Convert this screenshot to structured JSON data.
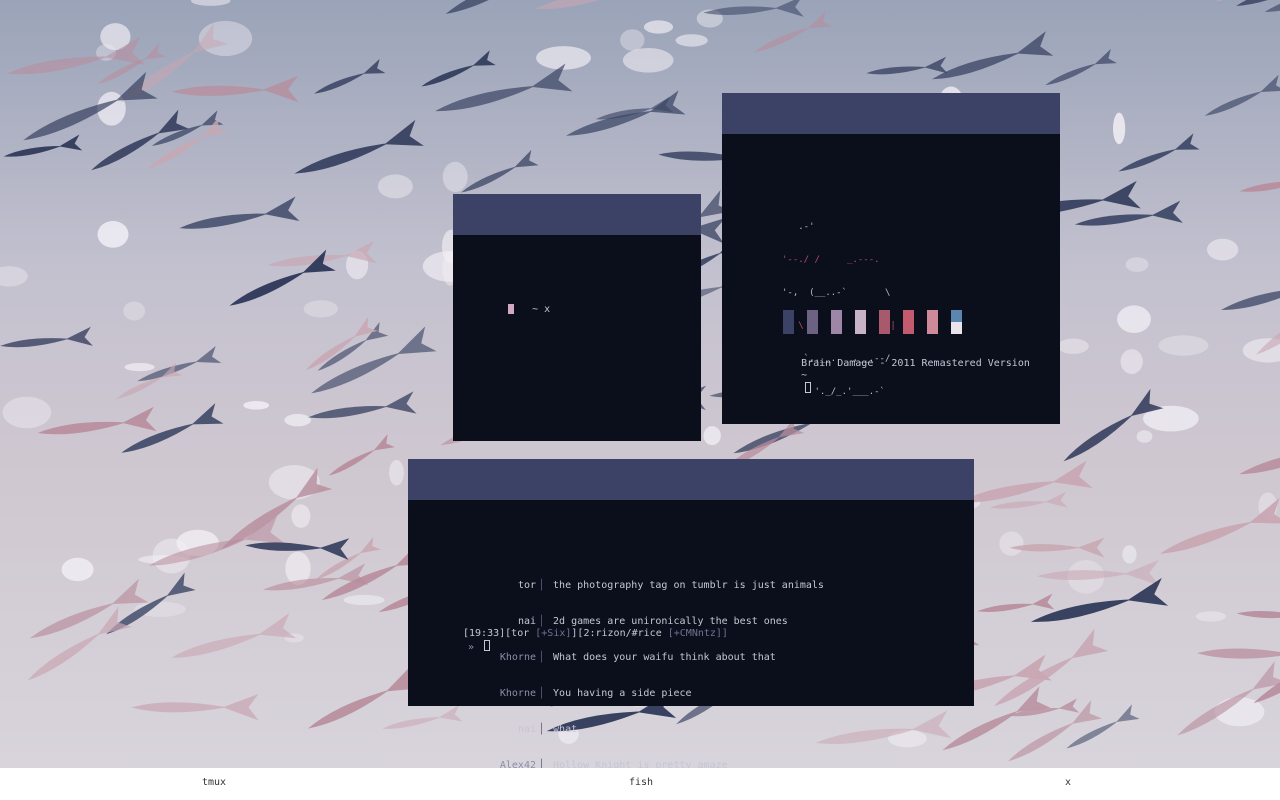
{
  "colors": {
    "titlebar": "#3c4265",
    "terminal_bg": "#0b0f1c",
    "terminal_fg": "#c4c6d4",
    "taskbar_bg": "#ffffff",
    "prompt_cursor": "#d2a8c0",
    "whale_outline": "#c9b7c5",
    "whale_accent": "#b94d67"
  },
  "taskbar": {
    "left_label": "tmux",
    "center_label": "fish",
    "right_label": "x"
  },
  "term_small": {
    "prompt": "~ x"
  },
  "term_neofetch": {
    "whale_ascii": [
      "   .-'",
      "'--./ /     _.---.",
      "'-,  (__..-`       \\",
      "   \\          .     |",
      "    `,.__.   ,__.--/",
      "      '._/_.'___.-`"
    ],
    "palette": [
      "#3c4265",
      "#6d6282",
      "#9d86a6",
      "#c7b3c7",
      "#a85a6c",
      "#c45a6e",
      "#cf8a9a",
      "#5a86b0"
    ],
    "palette_bottom": "#e9e4ec",
    "track_info": "Brain Damage - 2011 Remastered Version",
    "prompt": "~"
  },
  "term_irc": {
    "messages": [
      {
        "nick": "tor",
        "text": "the photography tag on tumblr is just animals",
        "nick_color": "#c4c6d4"
      },
      {
        "nick": "nai",
        "text": "2d games are unironically the best ones",
        "nick_color": "#c4c6d4"
      },
      {
        "nick": "Khorne",
        "text": "What does your waifu think about that",
        "nick_color": "#8a8ea8"
      },
      {
        "nick": "Khorne",
        "text": "You having a side piece",
        "nick_color": "#8a8ea8"
      },
      {
        "nick": "nai",
        "text": "what",
        "nick_color": "#c4c6d4"
      },
      {
        "nick": "Alex42",
        "text": "Hollow Knight is pretty amaze",
        "nick_color": "#8a8ea8"
      }
    ],
    "status": {
      "time": "[19:33]",
      "user": "[tor ",
      "user_mode": "[+Six]",
      "user_close": "]",
      "channel": "[2:rizon/#rice ",
      "channel_mode": "[+CMNntz]",
      "channel_close": "]"
    },
    "input_prompt": "»"
  }
}
